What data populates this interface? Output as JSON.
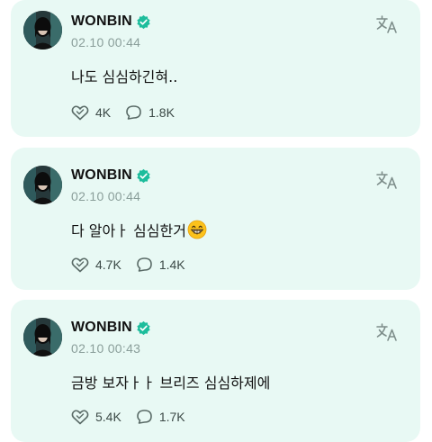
{
  "posts": [
    {
      "author": "WONBIN",
      "time": "02.10 00:44",
      "text": "나도 심심하긴혀..",
      "emoji": "",
      "likes": "4K",
      "comments": "1.8K"
    },
    {
      "author": "WONBIN",
      "time": "02.10 00:44",
      "text": "다 알아ㅏ 심심한거",
      "emoji": "grinning-face-emoji",
      "likes": "4.7K",
      "comments": "1.4K"
    },
    {
      "author": "WONBIN",
      "time": "02.10 00:43",
      "text": "금방 보자ㅏㅏ 브리즈 심심하제에",
      "emoji": "",
      "likes": "5.4K",
      "comments": "1.7K"
    }
  ],
  "icons": {
    "verified": "verified-badge-icon",
    "translate": "translate-icon",
    "like": "like-icon",
    "comment": "comment-icon"
  },
  "colors": {
    "card_background": "#e8f9f4",
    "verified_badge": "#1dbd9c",
    "timestamp": "#8a9e9a",
    "icon": "#5a6b67"
  }
}
